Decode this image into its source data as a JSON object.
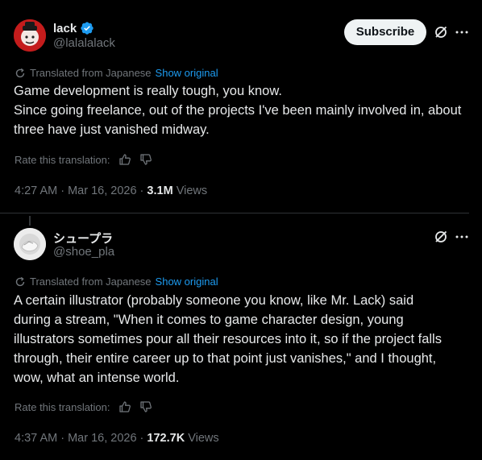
{
  "post1": {
    "display_name": "lack",
    "handle": "@lalalalack",
    "subscribe_label": "Subscribe",
    "translated_label": "Translated from Japanese",
    "show_original_label": "Show original",
    "body": "Game development is really tough, you know.\nSince going freelance, out of the projects I've been mainly involved in, about three have just vanished midway.",
    "rate_label": "Rate this translation:",
    "timestamp": "4:27 AM · Mar 16, 2026 · ",
    "views_count": "3.1M",
    "views_label": " Views"
  },
  "post2": {
    "display_name": "シュープラ",
    "handle": "@shoe_pla",
    "translated_label": "Translated from Japanese",
    "show_original_label": "Show original",
    "body": "A certain illustrator (probably someone you know, like Mr. Lack) said during a stream, \"When it comes to game character design, young illustrators sometimes pour all their resources into it, so if the project falls through, their entire career up to that point just vanishes,\" and I thought, wow, what an intense world.",
    "rate_label": "Rate this translation:",
    "timestamp": "4:37 AM · Mar 16, 2026 · ",
    "views_count": "172.7K",
    "views_label": " Views"
  },
  "icons": {
    "verified": "verified-badge-icon",
    "grok": "grok-icon",
    "more": "more-icon",
    "translate": "translate-icon",
    "thumbs_up": "thumbs-up-icon",
    "thumbs_down": "thumbs-down-icon"
  },
  "colors": {
    "background": "#000000",
    "text": "#e7e9ea",
    "muted": "#71767b",
    "link": "#1d9bf0",
    "verified": "#1d9bf0",
    "subscribe_bg": "#eff3f4"
  }
}
